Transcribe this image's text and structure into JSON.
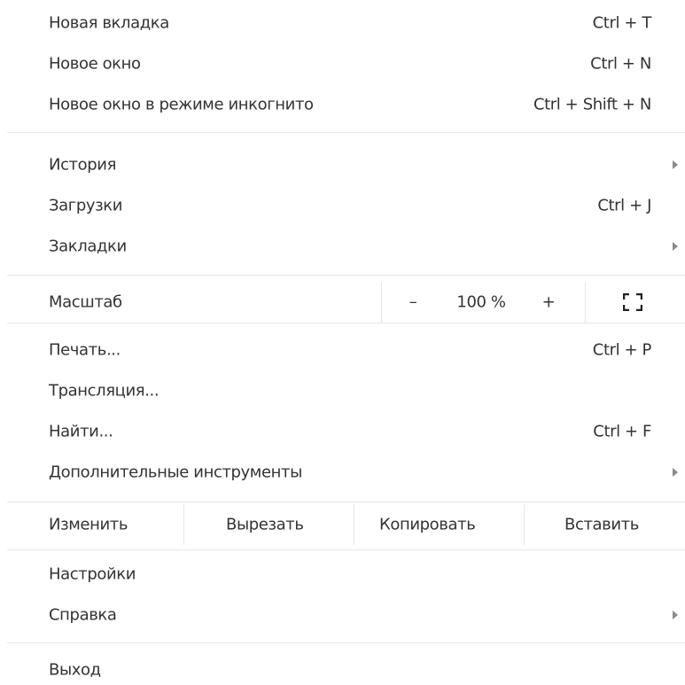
{
  "menu": {
    "group1": [
      {
        "label": "Новая вкладка",
        "shortcut": "Ctrl + T"
      },
      {
        "label": "Новое окно",
        "shortcut": "Ctrl + N"
      },
      {
        "label": "Новое окно в режиме инкогнито",
        "shortcut": "Ctrl + Shift + N"
      }
    ],
    "group2": [
      {
        "label": "История",
        "shortcut": ""
      },
      {
        "label": "Загрузки",
        "shortcut": "Ctrl + J"
      },
      {
        "label": "Закладки",
        "shortcut": ""
      }
    ],
    "zoom": {
      "label": "Масштаб",
      "minus": "–",
      "level": "100 %",
      "plus": "+",
      "fullscreen_icon": "fullscreen-icon"
    },
    "group3": [
      {
        "label": "Печать...",
        "shortcut": "Ctrl + P"
      },
      {
        "label": "Трансляция...",
        "shortcut": ""
      },
      {
        "label": "Найти...",
        "shortcut": "Ctrl + F"
      },
      {
        "label": "Дополнительные инструменты",
        "shortcut": ""
      }
    ],
    "edit": {
      "label": "Изменить",
      "cut": "Вырезать",
      "copy": "Копировать",
      "paste": "Вставить"
    },
    "group4": [
      {
        "label": "Настройки"
      },
      {
        "label": "Справка"
      }
    ],
    "exit": {
      "label": "Выход"
    }
  },
  "colors": {
    "text": "#333333",
    "separator": "#e6e6e6",
    "arrow": "#8a8a8a",
    "background": "#ffffff"
  }
}
